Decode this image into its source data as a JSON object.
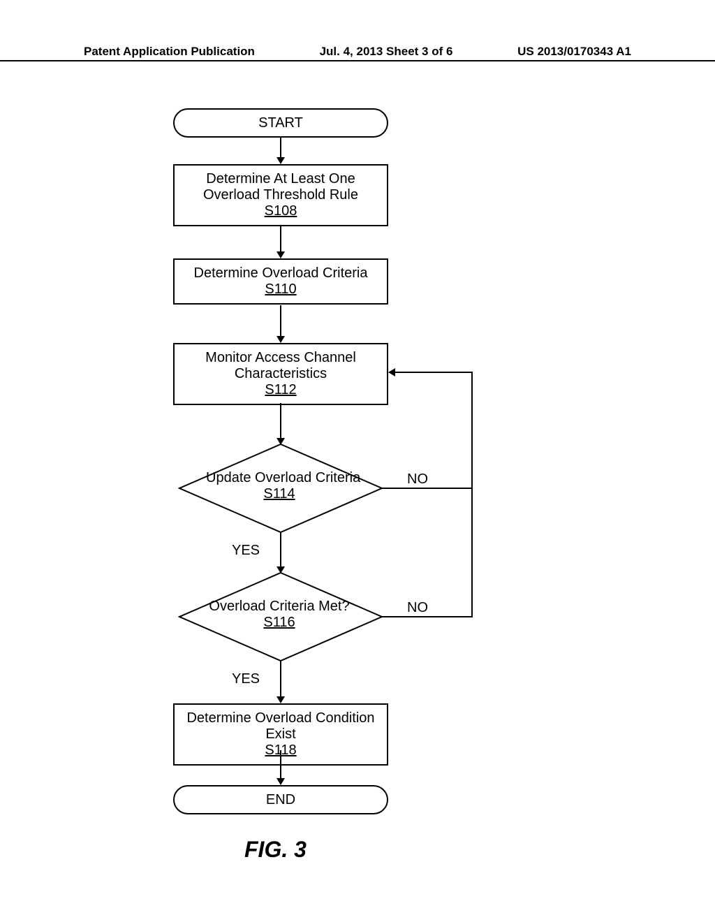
{
  "header": {
    "left": "Patent Application Publication",
    "center": "Jul. 4, 2013   Sheet 3 of 6",
    "right": "US 2013/0170343 A1"
  },
  "flow": {
    "start": "START",
    "s108_text": "Determine At Least One Overload Threshold Rule",
    "s108_ref": "S108",
    "s110_text": "Determine Overload Criteria",
    "s110_ref": "S110",
    "s112_text": "Monitor Access Channel Characteristics",
    "s112_ref": "S112",
    "s114_text": "Update Overload Criteria",
    "s114_ref": "S114",
    "s114_yes": "YES",
    "s114_no": "NO",
    "s116_text": "Overload Criteria Met?",
    "s116_ref": "S116",
    "s116_yes": "YES",
    "s116_no": "NO",
    "s118_text": "Determine Overload Condition Exist",
    "s118_ref": "S118",
    "end": "END",
    "figure": "FIG. 3"
  }
}
